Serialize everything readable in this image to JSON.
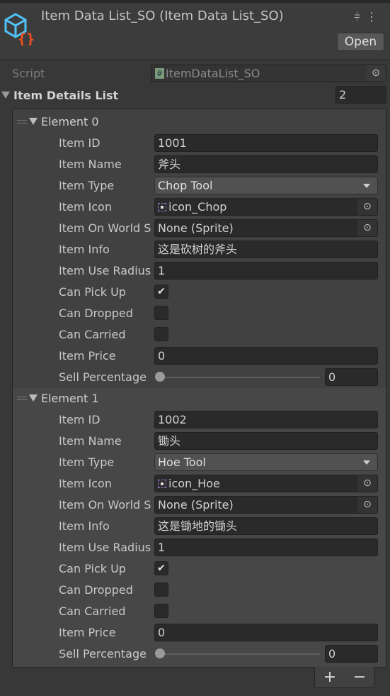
{
  "header": {
    "title": "Item Data List_SO (Item Data List_SO)",
    "open_label": "Open",
    "icon": "scriptable-object-icon"
  },
  "script": {
    "label": "Script",
    "value": "ItemDataList_SO"
  },
  "list": {
    "label": "Item Details List",
    "size": "2"
  },
  "labels": {
    "id": "Item ID",
    "name": "Item Name",
    "type": "Item Type",
    "icon": "Item Icon",
    "world": "Item On World Sprite",
    "info": "Item Info",
    "radius": "Item Use Radius",
    "pick": "Can Pick Up",
    "drop": "Can Dropped",
    "carry": "Can Carried",
    "price": "Item Price",
    "sell": "Sell Percentage"
  },
  "elements": [
    {
      "title": "Element 0",
      "id": "1001",
      "name": "斧头",
      "type": "Chop Tool",
      "icon": "icon_Chop",
      "world": "None (Sprite)",
      "info": "这是砍树的斧头",
      "radius": "1",
      "pick": true,
      "drop": false,
      "carry": false,
      "price": "0",
      "sell": "0"
    },
    {
      "title": "Element 1",
      "id": "1002",
      "name": "锄头",
      "type": "Hoe Tool",
      "icon": "icon_Hoe",
      "world": "None (Sprite)",
      "info": "这是锄地的锄头",
      "radius": "1",
      "pick": true,
      "drop": false,
      "carry": false,
      "price": "0",
      "sell": "0"
    }
  ],
  "footer": {
    "add": "+",
    "remove": "−"
  }
}
